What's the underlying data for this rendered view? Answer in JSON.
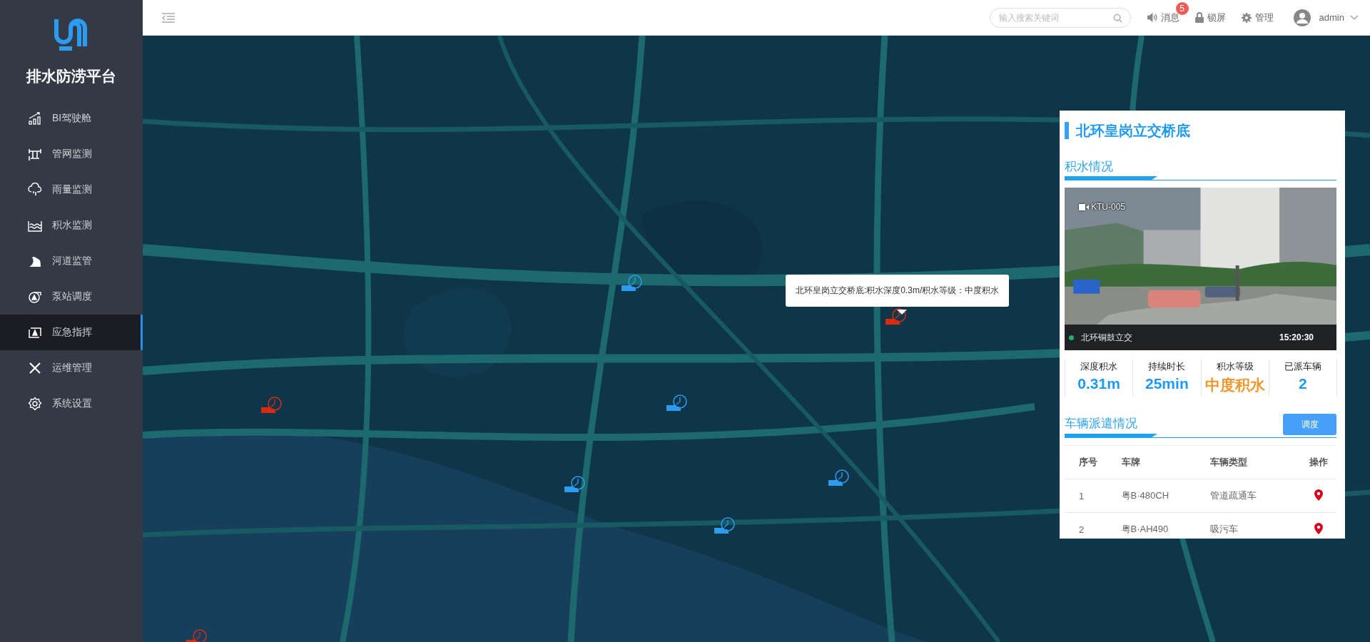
{
  "sidebar": {
    "title": "排水防涝平台",
    "items": [
      {
        "label": "BI驾驶舱",
        "kind": "chart",
        "selected": false
      },
      {
        "label": "管网监测",
        "kind": "pipe",
        "selected": false
      },
      {
        "label": "雨量监测",
        "kind": "rain",
        "selected": false
      },
      {
        "label": "积水监测",
        "kind": "water",
        "selected": false
      },
      {
        "label": "河道监管",
        "kind": "river",
        "selected": false
      },
      {
        "label": "泵站调度",
        "kind": "pump",
        "selected": false
      },
      {
        "label": "应急指挥",
        "kind": "command",
        "selected": true
      },
      {
        "label": "运维管理",
        "kind": "tools",
        "selected": false
      },
      {
        "label": "系统设置",
        "kind": "gear",
        "selected": false
      }
    ]
  },
  "header": {
    "search": {
      "placeholder": "输入搜索关键词"
    },
    "messages": {
      "label": "消息",
      "badge": "5"
    },
    "lock": "锁屏",
    "manage": "管理",
    "user": "admin"
  },
  "map": {
    "markers": [
      {
        "kind": "vehicle"
      },
      {
        "kind": "vehicle"
      },
      {
        "kind": "vehicle"
      },
      {
        "kind": "vehicle"
      },
      {
        "kind": "vehicle"
      },
      {
        "kind": "alert"
      },
      {
        "kind": "alert"
      },
      {
        "kind": "alert"
      }
    ],
    "tooltip": "北环皇岗立交桥底:积水深度0.3m/积水等级：中度积水"
  },
  "panel": {
    "title": "北环皇岗立交桥底",
    "water_section": "积水情况",
    "camera": {
      "id": "KTU-005",
      "location": "北环铜鼓立交",
      "time": "15:20:30",
      "online": true
    },
    "stats": [
      {
        "label": "深度积水",
        "value": "0.31m",
        "kind": "normal"
      },
      {
        "label": "持续时长",
        "value": "25min",
        "kind": "normal"
      },
      {
        "label": "积水等级",
        "value": "中度积水",
        "kind": "warning"
      },
      {
        "label": "已派车辆",
        "value": "2",
        "kind": "normal"
      }
    ],
    "dispatch_section": "车辆派遣情况",
    "dispatch_button": "调度",
    "table": {
      "columns": [
        "序号",
        "车牌",
        "车辆类型",
        "操作"
      ],
      "rows": [
        {
          "no": "1",
          "plate": "粤B·480CH",
          "type": "管道疏通车"
        },
        {
          "no": "2",
          "plate": "粤B·AH490",
          "type": "吸污车"
        }
      ]
    }
  }
}
